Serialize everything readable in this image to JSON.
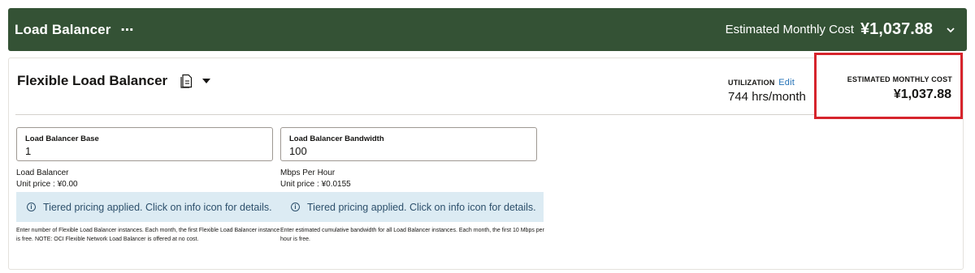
{
  "header": {
    "title": "Load Balancer",
    "more_icon": "⋯",
    "cost_label": "Estimated Monthly Cost",
    "cost_value": "¥1,037.88"
  },
  "card": {
    "title": "Flexible Load Balancer",
    "utilization": {
      "label": "UTILIZATION",
      "edit": "Edit",
      "value": "744 hrs/month"
    },
    "estimated_cost": {
      "label": "ESTIMATED MONTHLY COST",
      "value": "¥1,037.88"
    },
    "fields": [
      {
        "label": "Load Balancer Base",
        "value": "1",
        "unit_name": "Load Balancer",
        "unit_price": "Unit price : ¥0.00",
        "info": "Tiered pricing applied. Click on info icon for details.",
        "help": "Enter number of Flexible Load Balancer instances. Each month, the first Flexible Load Balancer instance is free. NOTE: OCI Flexible Network Load Balancer is offered at no cost."
      },
      {
        "label": "Load Balancer Bandwidth",
        "value": "100",
        "unit_name": "Mbps Per Hour",
        "unit_price": "Unit price : ¥0.0155",
        "info": "Tiered pricing applied. Click on info icon for details.",
        "help": "Enter estimated cumulative bandwidth for all Load Balancer instances. Each month, the first 10 Mbps per hour is free."
      }
    ]
  },
  "colors": {
    "header_bg": "#345235",
    "highlight_border": "#d6242c",
    "info_bg": "#dcebf3",
    "link": "#1f6fb5"
  },
  "icons": {
    "more": "more-icon",
    "expand": "chevron-down-icon",
    "doc": "document-icon",
    "dropdown": "caret-down-icon",
    "info": "info-icon"
  }
}
